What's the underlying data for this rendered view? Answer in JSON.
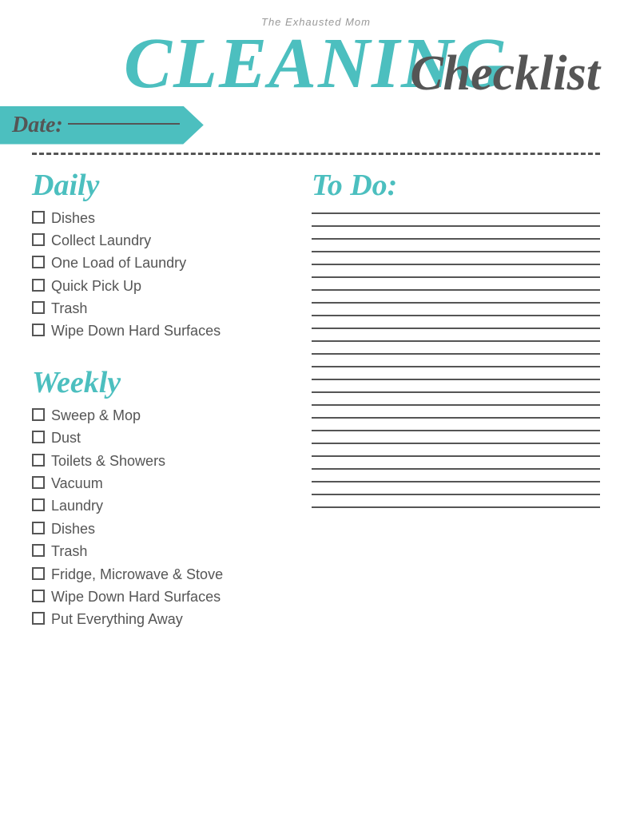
{
  "header": {
    "site_name": "The Exhausted Mom",
    "cleaning": "Cleaning",
    "checklist": "Checklist",
    "date_label": "Date:"
  },
  "daily": {
    "heading": "Daily",
    "items": [
      "Dishes",
      "Collect Laundry",
      "One Load of Laundry",
      "Quick Pick Up",
      "Trash",
      "Wipe Down Hard Surfaces"
    ]
  },
  "weekly": {
    "heading": "Weekly",
    "items": [
      "Sweep & Mop",
      "Dust",
      "Toilets & Showers",
      "Vacuum",
      "Laundry",
      "Dishes",
      "Trash",
      "Fridge, Microwave & Stove",
      "Wipe Down Hard Surfaces",
      "Put Everything Away"
    ]
  },
  "todo": {
    "heading": "To Do:",
    "line_count": 24
  },
  "colors": {
    "teal": "#4cbfbf",
    "dark": "#555555"
  }
}
